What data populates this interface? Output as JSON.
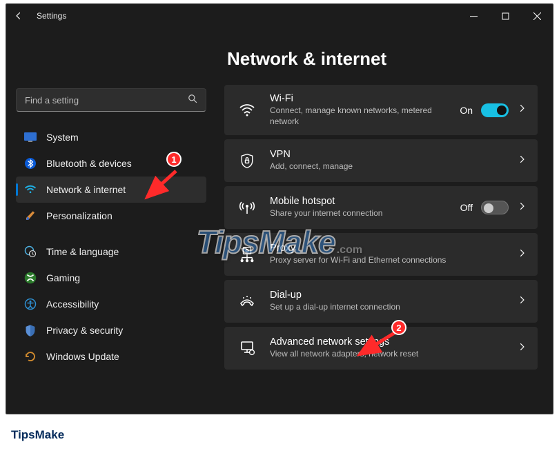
{
  "app": {
    "title": "Settings"
  },
  "search": {
    "placeholder": "Find a setting"
  },
  "nav": {
    "items": [
      {
        "icon": "system",
        "label": "System"
      },
      {
        "icon": "bluetooth",
        "label": "Bluetooth & devices"
      },
      {
        "icon": "wifi",
        "label": "Network & internet",
        "active": true
      },
      {
        "icon": "brush",
        "label": "Personalization"
      },
      {
        "icon": "globe-clock",
        "label": "Time & language"
      },
      {
        "icon": "gaming",
        "label": "Gaming"
      },
      {
        "icon": "accessibility",
        "label": "Accessibility"
      },
      {
        "icon": "shield",
        "label": "Privacy & security"
      },
      {
        "icon": "update",
        "label": "Windows Update"
      }
    ],
    "gap_after_index": 3
  },
  "page": {
    "title": "Network & internet"
  },
  "rows": [
    {
      "icon": "wifi",
      "title": "Wi-Fi",
      "sub": "Connect, manage known networks, metered network",
      "state": "On",
      "toggle": true
    },
    {
      "icon": "vpn",
      "title": "VPN",
      "sub": "Add, connect, manage"
    },
    {
      "icon": "hotspot",
      "title": "Mobile hotspot",
      "sub": "Share your internet connection",
      "state": "Off",
      "toggle": true
    },
    {
      "icon": "proxy",
      "title": "Proxy",
      "sub": "Proxy server for Wi-Fi and Ethernet connections"
    },
    {
      "icon": "dialup",
      "title": "Dial-up",
      "sub": "Set up a dial-up internet connection"
    },
    {
      "icon": "advanced",
      "title": "Advanced network settings",
      "sub": "View all network adapters, network reset"
    }
  ],
  "annotations": {
    "badge1": "1",
    "badge2": "2"
  },
  "watermark": {
    "main": "TipsMake",
    "suffix": ".com"
  },
  "footer": {
    "brand": "TipsMake"
  }
}
